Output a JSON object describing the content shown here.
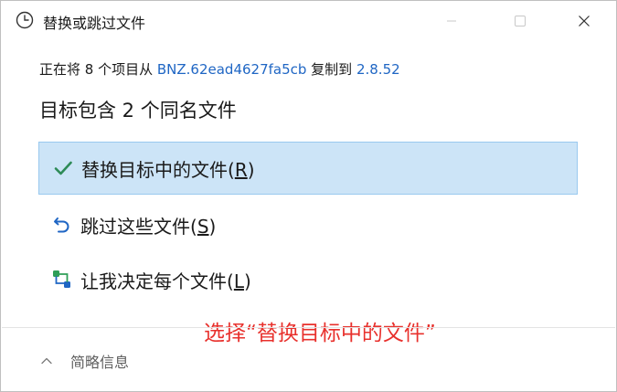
{
  "window": {
    "title": "替换或跳过文件",
    "icon": "clock-icon"
  },
  "copy_info": {
    "prefix": "正在将 8 个项目从 ",
    "source": "BNZ.62ead4627fa5cb",
    "middle": " 复制到 ",
    "destination": "2.8.52"
  },
  "heading": "目标包含 2 个同名文件",
  "options": [
    {
      "label": "替换目标中的文件(",
      "accel": "R",
      "suffix": ")",
      "icon": "checkmark-icon",
      "selected": true
    },
    {
      "label": "跳过这些文件(",
      "accel": "S",
      "suffix": ")",
      "icon": "skip-undo-icon",
      "selected": false
    },
    {
      "label": "让我决定每个文件(",
      "accel": "L",
      "suffix": ")",
      "icon": "compare-files-icon",
      "selected": false
    }
  ],
  "annotation": "选择“替换目标中的文件”",
  "footer": {
    "toggle_label": "简略信息",
    "icon": "chevron-up-icon"
  },
  "colors": {
    "link": "#1f66c4",
    "selected_bg": "#cce4f7",
    "selected_border": "#99c9ef",
    "check": "#2e8b57",
    "annotation": "#e8302c"
  }
}
